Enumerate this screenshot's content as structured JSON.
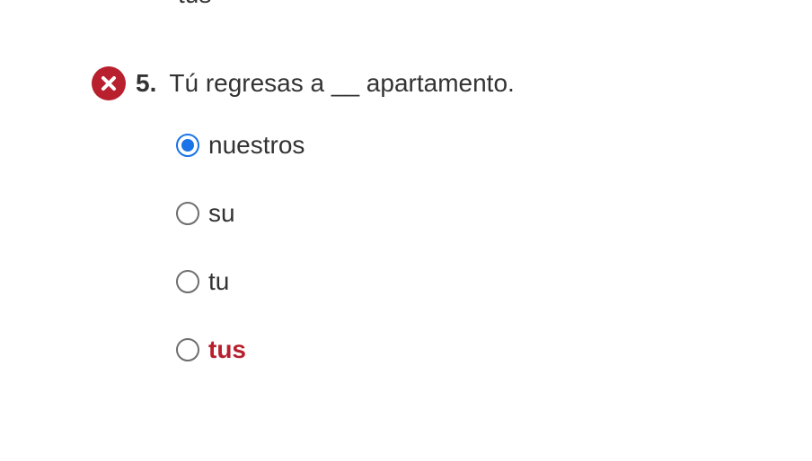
{
  "previous_question": {
    "last_option_label": "tus"
  },
  "question": {
    "status_icon": "incorrect-x-icon",
    "number": "5.",
    "text": "Tú regresas a __ apartamento.",
    "options": [
      {
        "label": "nuestros",
        "selected": true,
        "correct": false
      },
      {
        "label": "su",
        "selected": false,
        "correct": false
      },
      {
        "label": "tu",
        "selected": false,
        "correct": false
      },
      {
        "label": "tus",
        "selected": false,
        "correct": true
      }
    ]
  },
  "colors": {
    "incorrect": "#b8202e",
    "selected": "#1a73e8",
    "text": "#333333"
  }
}
